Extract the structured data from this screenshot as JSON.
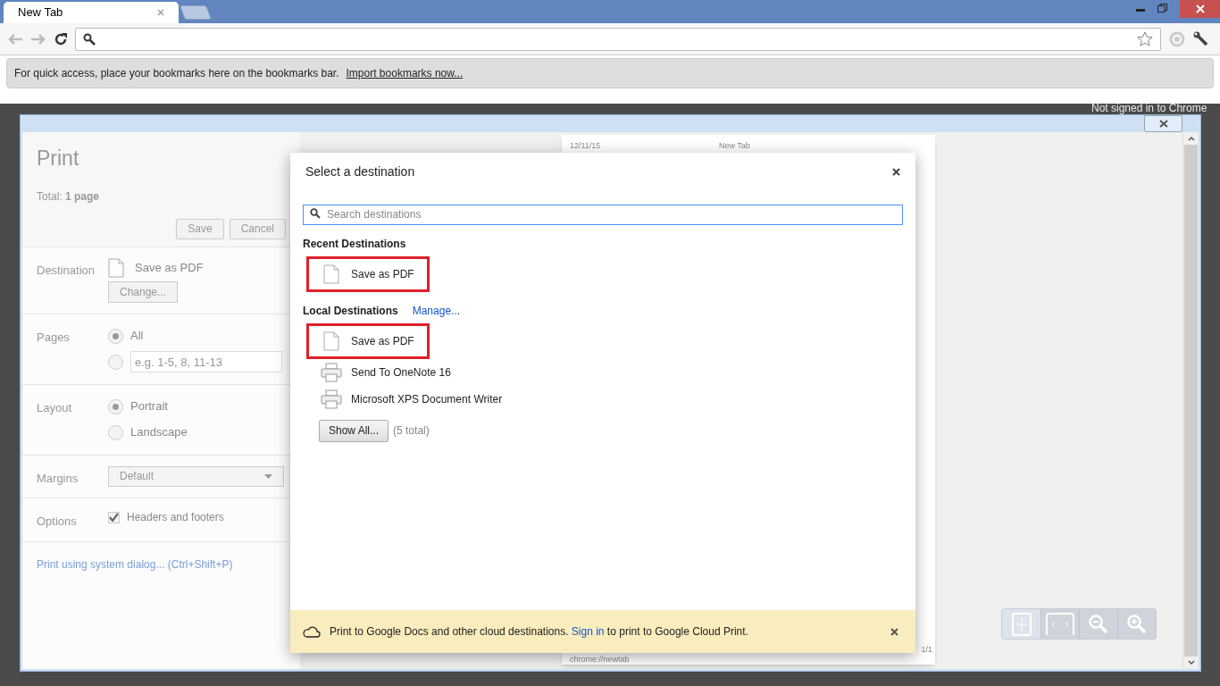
{
  "browser": {
    "tabs": [
      {
        "label": "New Tab",
        "selected": true
      }
    ],
    "bookmarks_bar": {
      "text": "For quick access, place your bookmarks here on the bookmarks bar.",
      "link": "Import bookmarks now..."
    },
    "background_text": "Not signed in to Chrome"
  },
  "print_panel": {
    "title": "Print",
    "total": "Total: **1 page**",
    "buttons": [
      "Save",
      "Cancel"
    ],
    "destination": {
      "label": "Destination",
      "value": "Save as PDF",
      "button": "Change..."
    },
    "pages": {
      "label": "Pages",
      "options": [
        {
          "kind": "label",
          "text": "All",
          "selected": true
        },
        {
          "kind": "input",
          "placeholder": "e.g. 1-5, 8, 11-13",
          "selected": false
        }
      ]
    },
    "layout": {
      "label": "Layout",
      "options": [
        {
          "kind": "label",
          "text": "Portrait",
          "selected": true
        },
        {
          "kind": "label",
          "text": "Landscape",
          "selected": false
        }
      ]
    },
    "margins": {
      "label": "Margins",
      "value": "Default"
    },
    "options": {
      "label": "Options",
      "text": "Headers and footers",
      "checked": true
    },
    "system_dialog_link": "Print using system dialog... (Ctrl+Shift+P)"
  },
  "preview": {
    "date": "12/11/15",
    "title": "New Tab",
    "url": "chrome://newtab",
    "page": "1/1"
  },
  "destination_dialog": {
    "title": "Select a destination",
    "search_placeholder": "Search destinations",
    "sections": [
      {
        "heading": "Recent Destinations",
        "items": [
          {
            "label": "Save as PDF",
            "kind": "file",
            "highlighted": true
          }
        ]
      },
      {
        "heading": "Local Destinations",
        "link": "Manage...",
        "items": [
          {
            "label": "Save as PDF",
            "kind": "file",
            "highlighted": true
          },
          {
            "label": "Send To OneNote 16",
            "kind": "printer",
            "highlighted": false
          },
          {
            "label": "Microsoft XPS Document Writer",
            "kind": "printer",
            "highlighted": false
          }
        ]
      }
    ],
    "show_all_button": "Show All...",
    "total_note": "(5 total)",
    "banner": {
      "before": "Print to Google Docs and other cloud destinations.",
      "link": "Sign in",
      "after": "to print to Google Cloud Print."
    }
  }
}
